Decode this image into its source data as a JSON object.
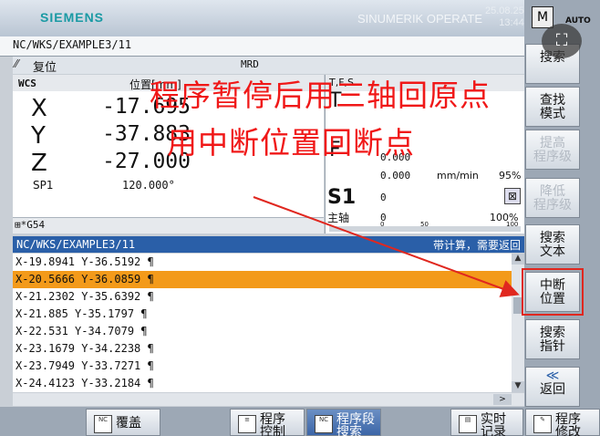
{
  "header": {
    "brand": "SIEMENS",
    "product": "SINUMERIK OPERATE",
    "date": "25.08.25",
    "time": "13:44"
  },
  "path": "NC/WKS/EXAMPLE3/11",
  "status": {
    "state": "复位",
    "mode": "MRD"
  },
  "position": {
    "frame": "WCS",
    "column_label": "位置[mm]",
    "axes": [
      {
        "name": "X",
        "value": "-17.695"
      },
      {
        "name": "Y",
        "value": "-37.883"
      },
      {
        "name": "Z",
        "value": "-27.000"
      }
    ],
    "spindle_name": "SP1",
    "spindle_value": "120.000°",
    "work_offset": "G54"
  },
  "tfs": {
    "header": "T,F,S",
    "T": "T",
    "F": "F",
    "f_actual": "0.000",
    "f_set": "0.000",
    "f_unit": "mm/min",
    "f_override": "95%",
    "S": "S1",
    "spindle_label": "主轴",
    "s_actual": "0",
    "s_set": "0",
    "s_override": "100%",
    "bar_ticks": [
      "0",
      "50",
      "100"
    ]
  },
  "program": {
    "path": "NC/WKS/EXAMPLE3/11",
    "status": "带计算，需要返回",
    "lines": [
      "X-19.8941 Y-36.5192 ¶",
      "X-20.5666 Y-36.0859 ¶",
      "X-21.2302 Y-35.6392 ¶",
      "X-21.885 Y-35.1797 ¶",
      "X-22.531 Y-34.7079 ¶",
      "X-23.1679 Y-34.2238 ¶",
      "X-23.7949 Y-33.7271 ¶",
      "X-24.4123 Y-33.2184 ¶"
    ],
    "selected_index": 1
  },
  "softkeys_right": [
    {
      "label": "搜索",
      "enabled": true
    },
    {
      "label": "查找\n模式",
      "enabled": true
    },
    {
      "label": "提高\n程序级",
      "enabled": false
    },
    {
      "label": "降低\n程序级",
      "enabled": false
    },
    {
      "label": "搜索\n文本",
      "enabled": true
    },
    {
      "label": "中断\n位置",
      "enabled": true
    },
    {
      "label": "搜索\n指针",
      "enabled": true
    },
    {
      "label": "返回",
      "enabled": true
    }
  ],
  "softkeys_bottom": [
    {
      "label": "覆盖"
    },
    {
      "label": "程序\n控制"
    },
    {
      "label": "程序段\n搜索"
    },
    {
      "label": "实时\n记录"
    },
    {
      "label": "程序\n修改"
    }
  ],
  "annotation": {
    "line1": "程序暂停后用三轴回原点",
    "line2": "用中断位置回断点",
    "color": "#f01818"
  },
  "colors": {
    "selection": "#f39a1a",
    "header_blue": "#2a5fa8",
    "brand": "#1a9aa4"
  }
}
